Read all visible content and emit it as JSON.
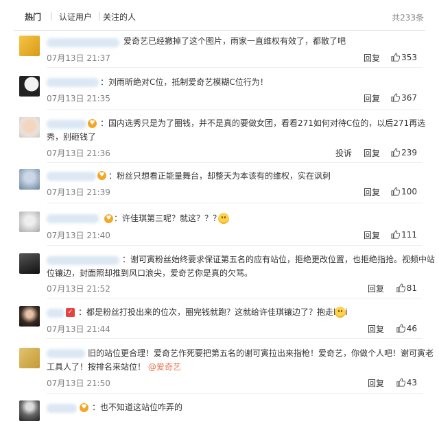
{
  "tabs": [
    "热门",
    "认证用户",
    "关注的人"
  ],
  "total_label": "共233条",
  "comments": [
    {
      "text": "爱奇艺已经撤掉了这个图片，雨家一直维权有效了，都散了吧",
      "time": "07月13日 21:37",
      "reply": "回复",
      "likes": "353"
    },
    {
      "text": "：刘雨昕绝对C位，抵制爱奇艺模糊C位行为！",
      "time": "07月13日 21:35",
      "reply": "回复",
      "likes": "367"
    },
    {
      "text1": "：国内选秀只是为了圈钱，并不是真的要做女团，看看271如何对待C位的，以后271再选",
      "text2": "秀，别砸钱了",
      "time": "07月13日 21:36",
      "report": "投诉",
      "reply": "回复",
      "likes": "239"
    },
    {
      "text": "：粉丝只想看正能量舞台，却整天为本该有的维权，实在讽刺",
      "time": "07月13日 21:39",
      "reply": "回复",
      "likes": "100"
    },
    {
      "text": "：许佳琪第三呢？就这？？？",
      "time": "07月13日 21:40",
      "reply": "回复",
      "likes": "111"
    },
    {
      "text1": "：谢可寅粉丝始终要求保证第五名的应有站位，拒绝更改位置，也拒绝指抢。视频中站",
      "text2": "位镶边，封面照却推到风口浪尖，爱奇艺你是真的欠骂。",
      "time": "07月13日 21:52",
      "reply": "回复",
      "likes": "81"
    },
    {
      "text": "：都是粉丝打投出来的位次，圈完钱就跑？这就给许佳琪镶边了？抱走kiki",
      "time": "07月13日 21:44",
      "reply": "回复",
      "likes": "46"
    },
    {
      "text1": "旧的站位更合理！爱奇艺作死要把第五名的谢可寅拉出来指枪！爱奇艺，你做个人吧！谢可寅老",
      "text2a": "工具人了！按排名来站位！",
      "mention": "@爱奇艺",
      "time": "07月13日 21:50",
      "reply": "回复",
      "likes": "43"
    },
    {
      "text": "：也不知道这站位咋弄的"
    }
  ]
}
